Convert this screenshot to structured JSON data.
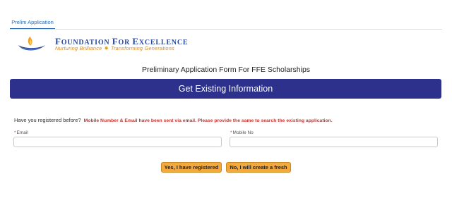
{
  "tabs": [
    {
      "label": "Prelim Application"
    }
  ],
  "logo": {
    "title_parts": [
      "F",
      "OUNDATION ",
      "F",
      "OR ",
      "E",
      "XCELLENCE"
    ],
    "tagline_left": "Nurturing Brilliance",
    "tagline_right": "Transforming Generations"
  },
  "form": {
    "title": "Preliminary Application Form For FFE Scholarships",
    "banner": "Get Existing Information",
    "question": "Have you registered before?",
    "note": "Mobile Number & Email have been sent via email. Please provide the same to search the existing application.",
    "fields": {
      "email": {
        "required_mark": "*",
        "label": "Email",
        "value": ""
      },
      "mobile": {
        "required_mark": "*",
        "label": "Mobile No",
        "value": ""
      }
    },
    "buttons": {
      "yes": "Yes, I have registered",
      "no": "No, I will create a fresh"
    }
  },
  "colors": {
    "accent_blue": "#2e318c",
    "tab_blue": "#2a6fb3",
    "button_orange": "#f3a93b",
    "warning_red": "#c23934"
  }
}
